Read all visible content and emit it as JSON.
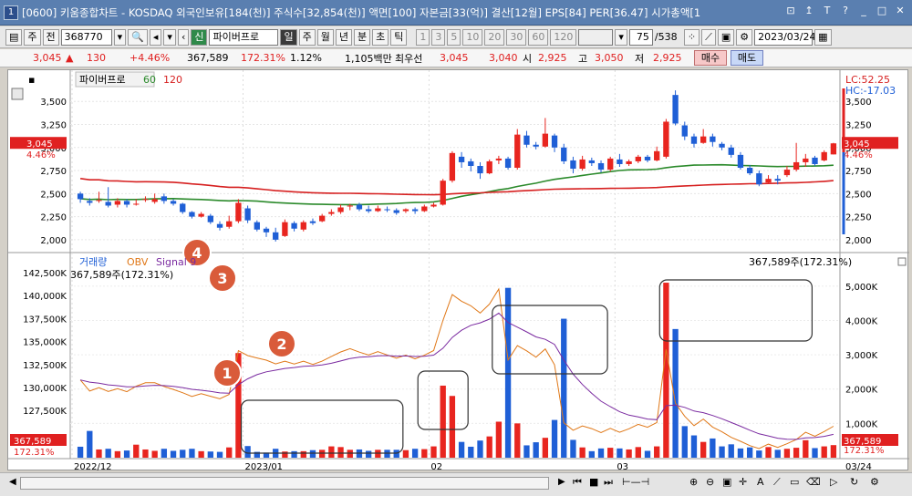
{
  "window": {
    "num": "1",
    "title": "[0600] 키움종합차트 - KOSDAQ 외국인보유[184(천)] 주식수[32,854(천)] 액면[100] 자본금[33(억)] 결산[12월] EPS[84] PER[36.47] 시가총액[1"
  },
  "toolbar": {
    "period_week": "주",
    "period_prev": "전",
    "code": "368770",
    "sin": "신",
    "name": "파이버프로",
    "tabs": [
      "일",
      "주",
      "월",
      "년",
      "분",
      "초",
      "틱"
    ],
    "minutes": [
      "1",
      "3",
      "5",
      "10",
      "20",
      "30",
      "60",
      "120"
    ],
    "count": "75",
    "total": "/538",
    "date": "2023/03/24"
  },
  "price": {
    "current": "3,045",
    "change": "130",
    "rate": "+4.46%",
    "volume": "367,589",
    "vol_rate": "172.31%",
    "turnover": "1.12%",
    "amount": "1,105백만",
    "best_sell_label": "최우선",
    "best_sell": "3,045",
    "best_buy": "3,040",
    "open_label": "시",
    "open": "2,925",
    "high_label": "고",
    "high": "3,050",
    "low_label": "저",
    "low": "2,925",
    "buy_btn": "매수",
    "sell_btn": "매도"
  },
  "legend": {
    "stock": "파이버프로",
    "ma60": "60",
    "ma120": "120",
    "lc": "LC:52.25",
    "hc": "HC:-17.03",
    "vol": "거래량",
    "obv": "OBV",
    "signal": "Signal 9",
    "vol_info": "367,589주(172.31%)",
    "vol_info_right": "367,589주(172.31%)",
    "price_tag": "3,045",
    "pct_tag": "4.46%",
    "vol_tag": "367,589",
    "vol_pct_tag": "172.31%"
  },
  "annotations": [
    "1",
    "2",
    "3",
    "4"
  ],
  "xaxis": [
    "2022/12",
    "2023/01",
    "02",
    "03",
    "03/24"
  ],
  "colors": {
    "up": "#e8251f",
    "down": "#1f5fd6",
    "ma60": "#2b8a2b",
    "ma120": "#d62020",
    "obv": "#e07818",
    "signal": "#7a2aa0",
    "annot": "#d95b3a"
  },
  "chart_data": {
    "type": "candlestick",
    "price_axis": [
      3500,
      3250,
      3000,
      2750,
      2500,
      2250,
      2000
    ],
    "obv_axis": [
      "142,500K",
      "140,000K",
      "137,500K",
      "135,000K",
      "132,500K",
      "130,000K",
      "127,500K"
    ],
    "vol_axis": [
      "5,000K",
      "4,000K",
      "3,000K",
      "2,000K",
      "1,000K"
    ],
    "candles": [
      [
        2500,
        2440,
        2520,
        2400
      ],
      [
        2420,
        2400,
        2450,
        2370
      ],
      [
        2430,
        2430,
        2520,
        2400
      ],
      [
        2410,
        2370,
        2570,
        2350
      ],
      [
        2380,
        2420,
        2450,
        2350
      ],
      [
        2420,
        2380,
        2440,
        2350
      ],
      [
        2390,
        2390,
        2440,
        2370
      ],
      [
        2440,
        2440,
        2470,
        2410
      ],
      [
        2410,
        2440,
        2500,
        2390
      ],
      [
        2470,
        2420,
        2500,
        2390
      ],
      [
        2420,
        2390,
        2440,
        2370
      ],
      [
        2390,
        2300,
        2400,
        2280
      ],
      [
        2300,
        2250,
        2310,
        2230
      ],
      [
        2250,
        2280,
        2300,
        2240
      ],
      [
        2260,
        2190,
        2280,
        2170
      ],
      [
        2170,
        2130,
        2200,
        2100
      ],
      [
        2140,
        2200,
        2260,
        2120
      ],
      [
        2200,
        2400,
        2440,
        2180
      ],
      [
        2340,
        2210,
        2370,
        2180
      ],
      [
        2190,
        2110,
        2210,
        2090
      ],
      [
        2120,
        2080,
        2140,
        2030
      ],
      [
        2080,
        2000,
        2130,
        1980
      ],
      [
        2040,
        2190,
        2220,
        2030
      ],
      [
        2180,
        2120,
        2200,
        2090
      ],
      [
        2110,
        2190,
        2210,
        2090
      ],
      [
        2200,
        2180,
        2230,
        2160
      ],
      [
        2200,
        2260,
        2280,
        2190
      ],
      [
        2280,
        2300,
        2330,
        2260
      ],
      [
        2300,
        2350,
        2380,
        2280
      ],
      [
        2360,
        2370,
        2390,
        2320
      ],
      [
        2380,
        2330,
        2400,
        2310
      ],
      [
        2330,
        2310,
        2370,
        2290
      ],
      [
        2310,
        2340,
        2370,
        2300
      ],
      [
        2330,
        2320,
        2360,
        2300
      ],
      [
        2320,
        2290,
        2340,
        2270
      ],
      [
        2310,
        2330,
        2340,
        2290
      ],
      [
        2330,
        2310,
        2350,
        2280
      ],
      [
        2310,
        2360,
        2380,
        2300
      ],
      [
        2360,
        2380,
        2400,
        2350
      ],
      [
        2380,
        2640,
        2660,
        2370
      ],
      [
        2640,
        2940,
        2960,
        2620
      ],
      [
        2900,
        2840,
        2950,
        2780
      ],
      [
        2850,
        2800,
        2880,
        2740
      ],
      [
        2800,
        2720,
        2840,
        2660
      ],
      [
        2720,
        2850,
        2870,
        2710
      ],
      [
        2860,
        2880,
        2910,
        2820
      ],
      [
        2880,
        2780,
        2900,
        2760
      ],
      [
        2780,
        3140,
        3200,
        2760
      ],
      [
        3130,
        3030,
        3180,
        3000
      ],
      [
        3030,
        3010,
        3060,
        2980
      ],
      [
        3010,
        3150,
        3320,
        3000
      ],
      [
        3130,
        3000,
        3150,
        2950
      ],
      [
        3000,
        2850,
        3040,
        2820
      ],
      [
        2860,
        2770,
        2900,
        2720
      ],
      [
        2770,
        2870,
        2910,
        2750
      ],
      [
        2860,
        2830,
        2890,
        2800
      ],
      [
        2830,
        2760,
        2860,
        2730
      ],
      [
        2760,
        2880,
        2900,
        2740
      ],
      [
        2870,
        2820,
        2930,
        2790
      ],
      [
        2820,
        2850,
        2870,
        2800
      ],
      [
        2850,
        2900,
        2920,
        2830
      ],
      [
        2900,
        2860,
        2920,
        2840
      ],
      [
        2860,
        2960,
        3010,
        2850
      ],
      [
        2900,
        3280,
        3310,
        2880
      ],
      [
        3570,
        3260,
        3620,
        3240
      ],
      [
        3240,
        3120,
        3280,
        3080
      ],
      [
        3120,
        3040,
        3150,
        3000
      ],
      [
        3050,
        3120,
        3200,
        3040
      ],
      [
        3120,
        3060,
        3150,
        3010
      ],
      [
        3040,
        3000,
        3060,
        2970
      ],
      [
        3000,
        2920,
        3030,
        2890
      ],
      [
        2920,
        2780,
        2950,
        2760
      ],
      [
        2780,
        2720,
        2810,
        2700
      ],
      [
        2720,
        2600,
        2750,
        2580
      ],
      [
        2620,
        2660,
        2700,
        2610
      ],
      [
        2660,
        2640,
        2700,
        2600
      ],
      [
        2700,
        2760,
        2800,
        2680
      ],
      [
        2760,
        2840,
        3050,
        2740
      ],
      [
        2840,
        2880,
        2930,
        2790
      ],
      [
        2890,
        2820,
        2910,
        2800
      ],
      [
        2860,
        2950,
        2970,
        2850
      ],
      [
        2925,
        3045,
        3050,
        2925
      ]
    ],
    "volume": [
      320,
      780,
      240,
      260,
      190,
      210,
      380,
      240,
      200,
      260,
      200,
      230,
      260,
      190,
      180,
      170,
      300,
      3050,
      340,
      170,
      150,
      260,
      180,
      190,
      190,
      220,
      230,
      330,
      310,
      230,
      240,
      200,
      230,
      230,
      230,
      220,
      260,
      250,
      330,
      2100,
      1800,
      460,
      320,
      500,
      620,
      1050,
      4950,
      1000,
      360,
      450,
      580,
      1100,
      4050,
      520,
      300,
      190,
      270,
      290,
      270,
      240,
      310,
      200,
      330,
      5100,
      3750,
      920,
      650,
      460,
      560,
      330,
      390,
      270,
      300,
      210,
      310,
      230,
      260,
      290,
      510,
      280,
      330,
      367
    ]
  }
}
